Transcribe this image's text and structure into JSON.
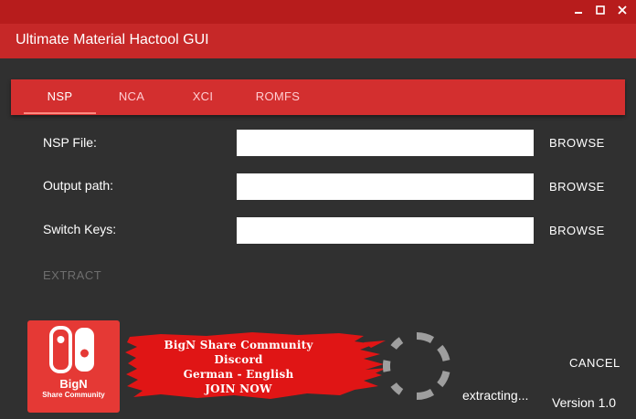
{
  "window": {
    "title": "Ultimate Material Hactool GUI",
    "controls": [
      "minimize-icon",
      "maximize-icon",
      "close-icon"
    ]
  },
  "tabs": [
    {
      "label": "NSP",
      "active": true
    },
    {
      "label": "NCA",
      "active": false
    },
    {
      "label": "XCI",
      "active": false
    },
    {
      "label": "ROMFS",
      "active": false
    }
  ],
  "form": {
    "nsp_file": {
      "label": "NSP File:",
      "value": "",
      "button": "BROWSE"
    },
    "output_path": {
      "label": "Output path:",
      "value": "",
      "button": "BROWSE"
    },
    "switch_keys": {
      "label": "Switch Keys:",
      "value": "",
      "button": "BROWSE"
    },
    "extract_label": "EXTRACT",
    "extract_enabled": false
  },
  "banner": {
    "logo_line1": "BigN",
    "logo_line2": "Share Community",
    "ad_lines": [
      "BigN Share Community",
      "Discord",
      "German - English",
      "JOIN NOW"
    ]
  },
  "status": {
    "text": "extracting...",
    "cancel_label": "CANCEL",
    "version": "Version 1.0"
  },
  "colors": {
    "background": "#303030",
    "titlebar": "#b71c1c",
    "appbar": "#c62828",
    "tabbar": "#d32f2f",
    "tab_indicator": "#ff8a80",
    "logo_red": "#e53935",
    "disabled_text": "#6e6e6e"
  }
}
